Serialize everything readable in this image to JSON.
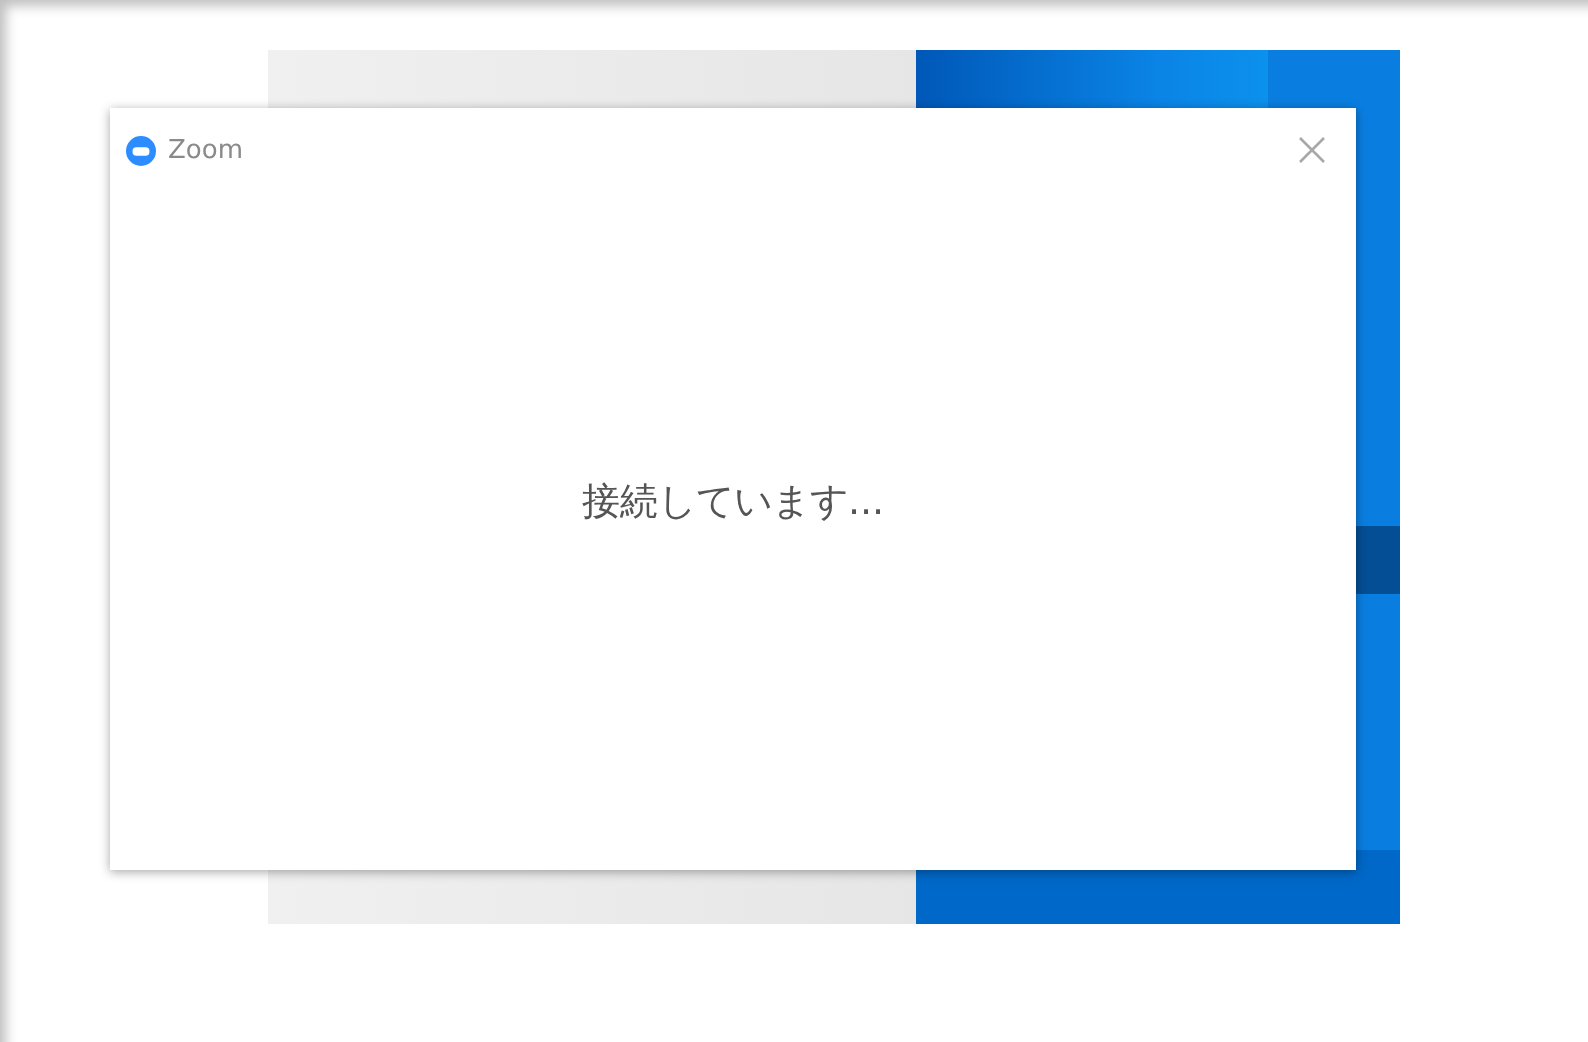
{
  "window": {
    "title": "Zoom"
  },
  "message": "接続しています..."
}
